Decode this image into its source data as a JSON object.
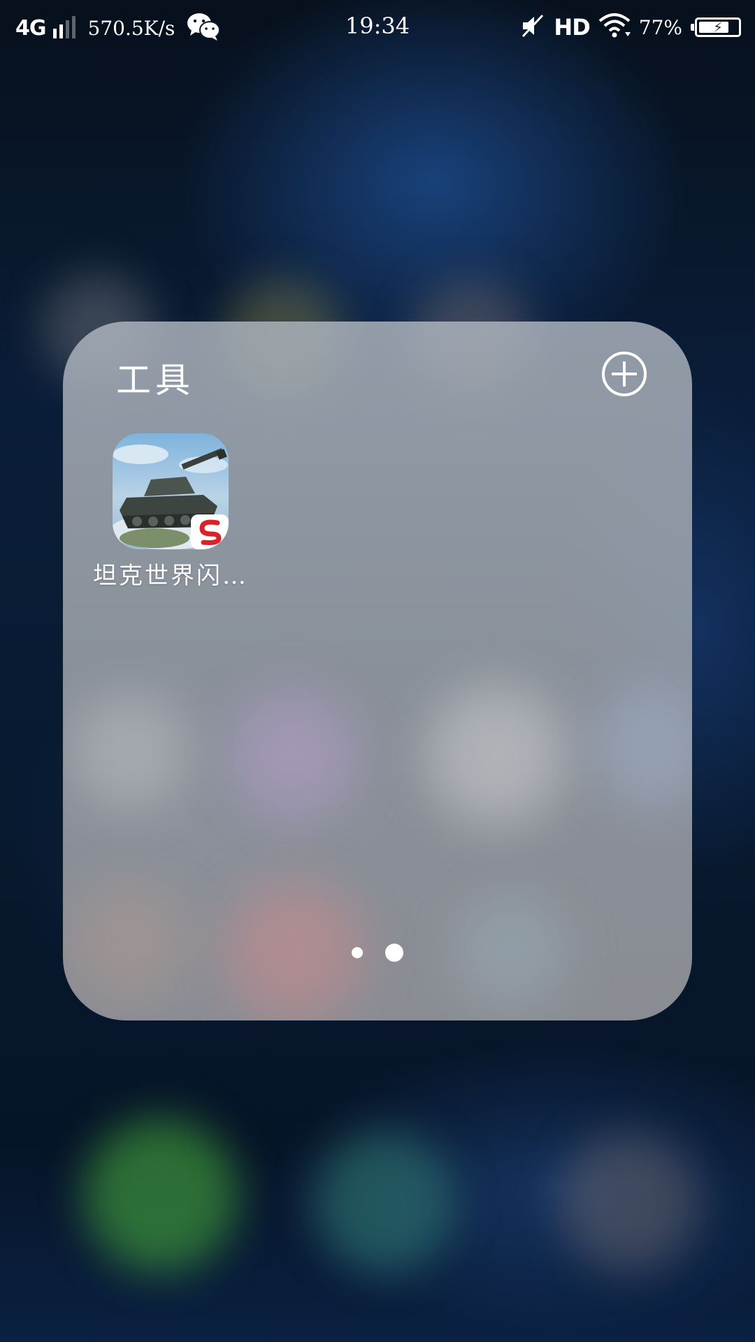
{
  "status_bar": {
    "network_type": "4G",
    "net_speed": "570.5K/s",
    "time": "19:34",
    "hd_label": "HD",
    "battery_percent": "77%",
    "battery_level": 0.77,
    "charging": true,
    "icons": [
      "signal-icon",
      "wechat-icon",
      "mute-icon",
      "wifi-icon",
      "battery-icon"
    ]
  },
  "folder": {
    "title": "工具",
    "add_button_icon": "add-circle-icon",
    "apps": [
      {
        "label": "坦克世界闪…",
        "icon": "tank-game-app-icon"
      }
    ],
    "page_count": 2,
    "current_page": 2
  },
  "colors": {
    "folder_bg": "#a6aab0",
    "text": "#ffffff"
  }
}
